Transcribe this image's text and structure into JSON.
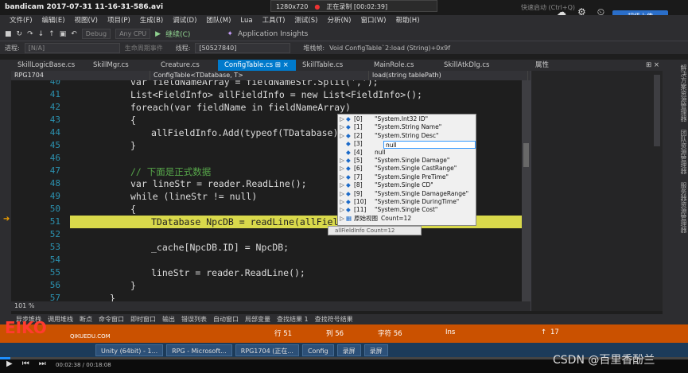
{
  "player": {
    "title": "bandicam 2017-07-31 11-16-31-586.avi",
    "resolution": "1280x720",
    "recording_label": "正在录制 [00:02:39]",
    "vs_quick_launch": "快速启动 (Ctrl+Q)",
    "upload_label": "超级上传",
    "time": "00:02:38 / 00:18:08",
    "progress_fraction": 0.015
  },
  "menu": [
    "文件(F)",
    "编辑(E)",
    "视图(V)",
    "项目(P)",
    "生成(B)",
    "调试(D)",
    "团队(M)",
    "Lua",
    "工具(T)",
    "测试(S)",
    "分析(N)",
    "窗口(W)",
    "帮助(H)"
  ],
  "toolbar": {
    "config": "Debug",
    "platform": "Any CPU",
    "continue_label": "继续(C)",
    "insights_label": "Application Insights"
  },
  "procbar": {
    "process_label": "进程:",
    "process_value": "[N/A]",
    "lifecycle_label": "生命周期事件",
    "thread_label": "线程:",
    "thread_value": "[50527840]",
    "stack_label": "堆栈帧:",
    "stack_value": "Void ConfigTable`2:load (String)+0x9f"
  },
  "tabs": [
    {
      "label": "SkillLogicBase.cs",
      "active": false
    },
    {
      "label": "SkillMgr.cs",
      "active": false
    },
    {
      "label": "Creature.cs",
      "active": false
    },
    {
      "label": "ConfigTable.cs",
      "active": true
    },
    {
      "label": "SkillTable.cs",
      "active": false
    },
    {
      "label": "MainRole.cs",
      "active": false
    },
    {
      "label": "SkillAtkDlg.cs",
      "active": false
    }
  ],
  "navbar": {
    "project": "RPG1704",
    "class": "ConfigTable<TDatabase, T>",
    "method": "load(string tablePath)"
  },
  "editor": {
    "zoom": "101 %",
    "lines": [
      {
        "n": "40",
        "text": "var fieldNameArray = fieldNameStr.Split(',');"
      },
      {
        "n": "41",
        "text": "List<FieldInfo> allFieldInfo = new List<FieldInfo>();"
      },
      {
        "n": "42",
        "text": "foreach(var fieldName in fieldNameArray)"
      },
      {
        "n": "43",
        "text": "{"
      },
      {
        "n": "44",
        "text": "allFieldInfo.Add(typeof(TDatabase)."
      },
      {
        "n": "45",
        "text": "}"
      },
      {
        "n": "46",
        "text": ""
      },
      {
        "n": "47",
        "text": "// 下面是正式数据"
      },
      {
        "n": "48",
        "text": "var lineStr = reader.ReadLine();"
      },
      {
        "n": "49",
        "text": "while (lineStr != null)"
      },
      {
        "n": "50",
        "text": "{"
      },
      {
        "n": "51",
        "text": "TDatabase NpcDB = readLine(allField"
      },
      {
        "n": "52",
        "text": ""
      },
      {
        "n": "53",
        "text": "_cache[NpcDB.ID] = NpcDB;"
      },
      {
        "n": "54",
        "text": ""
      },
      {
        "n": "55",
        "text": "lineStr = reader.ReadLine();"
      },
      {
        "n": "56",
        "text": "}"
      },
      {
        "n": "57",
        "text": "}"
      }
    ]
  },
  "datatip": {
    "rows": [
      {
        "idx": "[0]",
        "val": "\"System.Int32 ID\""
      },
      {
        "idx": "[1]",
        "val": "\"System.String Name\""
      },
      {
        "idx": "[2]",
        "val": "\"System.String Desc\""
      },
      {
        "idx": "[3]",
        "val": "null"
      },
      {
        "idx": "[4]",
        "val": "null"
      },
      {
        "idx": "[5]",
        "val": "\"System.Single Damage\""
      },
      {
        "idx": "[6]",
        "val": "\"System.Single CastRange\""
      },
      {
        "idx": "[7]",
        "val": "\"System.Single PreTime\""
      },
      {
        "idx": "[8]",
        "val": "\"System.Single CD\""
      },
      {
        "idx": "[9]",
        "val": "\"System.Single DamageRange\""
      },
      {
        "idx": "[10]",
        "val": "\"System.Single DuringTime\""
      },
      {
        "idx": "[11]",
        "val": "\"System.Single Cost\""
      },
      {
        "idx": "原始视图",
        "val": "Count=12"
      }
    ],
    "sub_label": "allFieldInfo   Count=12"
  },
  "props_title": "属性",
  "side_tabs": [
    "解决方案资源管理器",
    "团队资源管理器",
    "服务器资源管理器"
  ],
  "tooltabs": [
    "异步堆栈",
    "调用堆栈",
    "断点",
    "命令窗口",
    "即时窗口",
    "输出",
    "错误列表",
    "自动窗口",
    "局部变量",
    "查找结果 1",
    "查找符号结果"
  ],
  "status": {
    "line": "行 51",
    "col": "列 56",
    "ch": "字符 56",
    "mode": "Ins",
    "changes": "17",
    "logo_text": "EIKO",
    "logo_sub": "QIKUEDU.COM"
  },
  "taskbar": [
    "Unity (64bit) - 1...",
    "RPG - Microsoft...",
    "RPG1704 (正在...",
    "Config",
    "录屏",
    "录屏"
  ],
  "watermark": "CSDN @百里香酚兰"
}
